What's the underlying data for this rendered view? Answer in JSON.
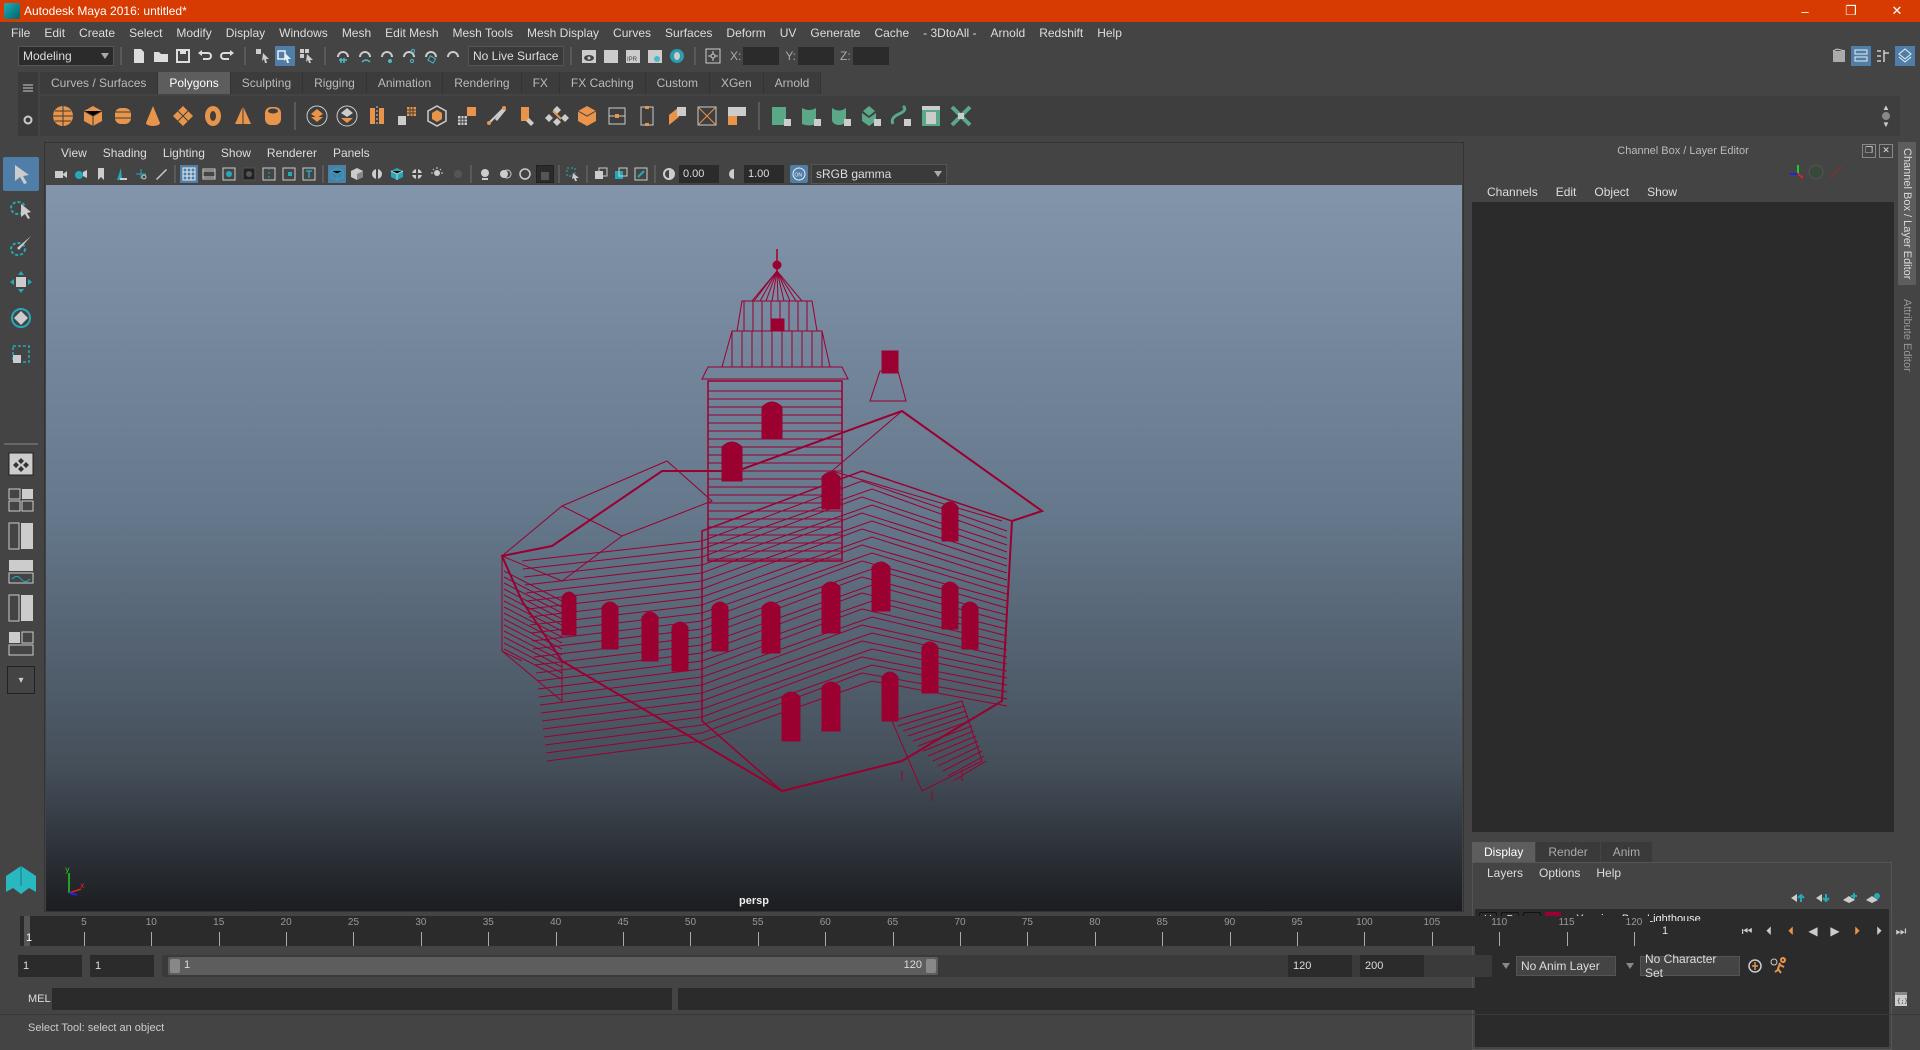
{
  "window": {
    "title": "Autodesk Maya 2016: untitled*",
    "controls": {
      "minimize": "–",
      "restore": "❐",
      "close": "✕"
    }
  },
  "menubar": {
    "items": [
      "File",
      "Edit",
      "Create",
      "Select",
      "Modify",
      "Display",
      "Windows",
      "Mesh",
      "Edit Mesh",
      "Mesh Tools",
      "Mesh Display",
      "Curves",
      "Surfaces",
      "Deform",
      "UV",
      "Generate",
      "Cache",
      "- 3DtoAll -",
      "Arnold",
      "Redshift",
      "Help"
    ]
  },
  "statusline": {
    "menuset": "Modeling",
    "live_surface": "No Live Surface",
    "coord_labels": {
      "x": "X:",
      "y": "Y:",
      "z": "Z:"
    },
    "coord_values": {
      "x": "",
      "y": "",
      "z": ""
    }
  },
  "shelf": {
    "tabs": [
      "Curves / Surfaces",
      "Polygons",
      "Sculpting",
      "Rigging",
      "Animation",
      "Rendering",
      "FX",
      "FX Caching",
      "Custom",
      "XGen",
      "Arnold"
    ],
    "active_tab": "Polygons",
    "accent_orange": "#e8944a",
    "accent_green": "#5aa887"
  },
  "viewport": {
    "menu": [
      "View",
      "Shading",
      "Lighting",
      "Show",
      "Renderer",
      "Panels"
    ],
    "exposure": "0.00",
    "gamma": "1.00",
    "color_space": "sRGB gamma",
    "camera_label": "persp",
    "axis": {
      "x": "x",
      "y": "y"
    },
    "wire_color": "#9a0030"
  },
  "channel_box": {
    "title": "Channel Box / Layer Editor",
    "menu": [
      "Channels",
      "Edit",
      "Object",
      "Show"
    ]
  },
  "layer_editor": {
    "tabs": [
      "Display",
      "Render",
      "Anim"
    ],
    "active_tab": "Display",
    "menu": [
      "Layers",
      "Options",
      "Help"
    ],
    "layers": [
      {
        "visible": "V",
        "playback": "P",
        "name": "...:Yaquina_Bay_Lighthouse",
        "color": "#9a0030"
      }
    ]
  },
  "side_tabs": [
    "Channel Box / Layer Editor",
    "Attribute Editor"
  ],
  "timeline": {
    "ticks": [
      5,
      10,
      15,
      20,
      25,
      30,
      35,
      40,
      45,
      50,
      55,
      60,
      65,
      70,
      75,
      80,
      85,
      90,
      95,
      100,
      105,
      110,
      115,
      120
    ],
    "min": 1,
    "max": 120,
    "current_frame": "1"
  },
  "range": {
    "start": "1",
    "anim_start": "1",
    "slider_start_label": "1",
    "slider_end_label": "120",
    "end": "120",
    "anim_end": "200",
    "anim_layer": "No Anim Layer",
    "character_set": "No Character Set"
  },
  "command_line": {
    "language": "MEL",
    "input": "",
    "output": ""
  },
  "help_line": {
    "text": "Select Tool: select an object"
  }
}
